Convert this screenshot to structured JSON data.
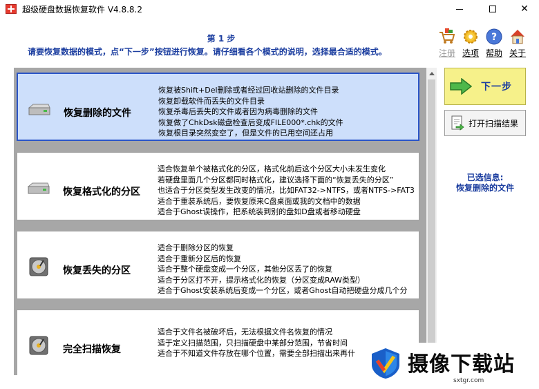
{
  "window": {
    "title": "超级硬盘数据恢复软件 V4.8.8.2"
  },
  "header": {
    "step_title": "第 1 步",
    "step_desc": "请要恢复数据的模式，点“下一步”按钮进行恢复。请仔细看各个模式的说明，选择最合适的模式。",
    "icons": [
      {
        "name": "cart-icon",
        "label": "注册",
        "disabled": true
      },
      {
        "name": "gear-icon",
        "label": "选项",
        "disabled": false
      },
      {
        "name": "help-icon",
        "label": "帮助",
        "disabled": false
      },
      {
        "name": "home-icon",
        "label": "关于",
        "disabled": false
      }
    ]
  },
  "modes": [
    {
      "name": "恢复删除的文件",
      "selected": true,
      "icon": "hard-drive-icon",
      "desc": [
        "恢复被Shift+Del删除或者经过回收站删除的文件目录",
        "恢复卸载软件而丢失的文件目录",
        "恢复杀毒后丢失的文件或者因为病毒删除的文件",
        "恢复做了ChkDsk磁盘检查后变成FILE000*.chk的文件",
        "恢复根目录突然变空了，但是文件的已用空间还占用"
      ]
    },
    {
      "name": "恢复格式化的分区",
      "selected": false,
      "icon": "hard-drive-icon",
      "desc": [
        "适合恢复单个被格式化的分区，格式化前后这个分区大小未发生变化",
        "若硬盘里面几个分区都同时格式化，建议选择下面的“恢复丢失的分区”",
        "也适合于分区类型发生改变的情况，比如FAT32->NTFS，或者NTFS->FAT3",
        "适合于重装系统后，要恢复原来C盘桌面或我的文档中的数据",
        "适合于Ghost误操作，把系统装到别的盘如D盘或者移动硬盘"
      ]
    },
    {
      "name": "恢复丢失的分区",
      "selected": false,
      "icon": "disk-platter-icon",
      "desc": [
        "适合于删除分区的恢复",
        "适合于重新分区后的恢复",
        "适合于整个硬盘变成一个分区，其他分区丢了的恢复",
        "适合于分区打不开，提示格式化的恢复（分区变成RAW类型）",
        "适合于Ghost安装系统后变成一个分区，或者Ghost自动把硬盘分成几个分"
      ]
    },
    {
      "name": "完全扫描恢复",
      "selected": false,
      "icon": "disk-platter-icon",
      "desc": [
        "适合于文件名被破坏后，无法根据文件名恢复的情况",
        "适于定义扫描范围，只扫描硬盘中某部分范围，节省时间",
        "适合于不知道文件存放在哪个位置，需要全部扫描出来再什"
      ]
    }
  ],
  "actions": {
    "next_label": "下一步",
    "open_scan_label": "打开扫描结果"
  },
  "selected_info": {
    "label": "已选信息:",
    "value": "恢复删除的文件"
  },
  "watermark": {
    "text": "摄像下载站",
    "url": "sxtgr.com"
  }
}
